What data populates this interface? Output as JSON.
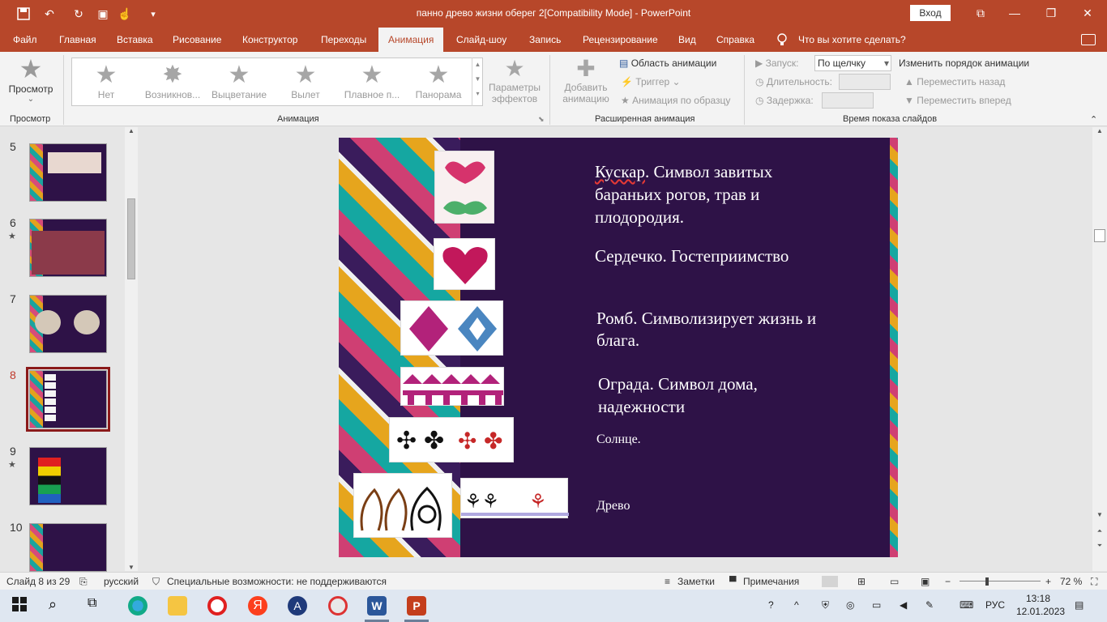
{
  "window": {
    "title": "панно древо жизни оберег 2[Compatibility Mode]  -  PowerPoint",
    "signin_label": "Вход",
    "minimize": "—",
    "restore": "❐",
    "close": "✕"
  },
  "tabs": {
    "items": [
      "Файл",
      "Главная",
      "Вставка",
      "Рисование",
      "Конструктор",
      "Переходы",
      "Анимация",
      "Слайд-шоу",
      "Запись",
      "Рецензирование",
      "Вид",
      "Справка"
    ],
    "active": "Анимация",
    "tell_me": "Что вы хотите сделать?"
  },
  "ribbon": {
    "preview": {
      "label": "Просмотр",
      "group": "Просмотр"
    },
    "animation_gallery": [
      "Нет",
      "Возникнов...",
      "Выцветание",
      "Вылет",
      "Плавное п...",
      "Панорама"
    ],
    "effect_options": [
      "Параметры",
      "эффектов"
    ],
    "animation_group": "Анимация",
    "add_animation": [
      "Добавить",
      "анимацию"
    ],
    "animation_pane": "Область анимации",
    "trigger": "Триггер",
    "animation_painter": "Анимация по образцу",
    "advanced_group": "Расширенная анимация",
    "start_label": "Запуск:",
    "start_value": "По щелчку",
    "duration_label": "Длительность:",
    "delay_label": "Задержка:",
    "reorder_title": "Изменить порядок анимации",
    "move_earlier": "Переместить назад",
    "move_later": "Переместить вперед",
    "timing_group": "Время показа слайдов"
  },
  "thumbnails": [
    {
      "num": "5",
      "star": ""
    },
    {
      "num": "6",
      "star": "★"
    },
    {
      "num": "7",
      "star": ""
    },
    {
      "num": "8",
      "star": ""
    },
    {
      "num": "9",
      "star": "★"
    },
    {
      "num": "10",
      "star": ""
    }
  ],
  "slide": {
    "t1": "Кускар. Символ завитых бараньих рогов, трав и плодородия.",
    "t1_first": "Кускар",
    "t1_rest": ". Символ завитых бараньих рогов, трав и плодородия.",
    "t2": "Сердечко. Гостеприимство",
    "t3": "Ромб. Символизирует жизнь и блага.",
    "t4": "Ограда. Символ дома, надежности",
    "t5": "Солнце.",
    "t6": "Древо"
  },
  "statusbar": {
    "slide": "Слайд 8 из 29",
    "language": "русский",
    "accessibility": "Специальные возможности: не поддерживаются",
    "notes": "Заметки",
    "comments": "Примечания",
    "zoom": "72 %"
  },
  "taskbar": {
    "lang": "РУС",
    "time": "13:18",
    "date": "12.01.2023"
  },
  "colors": {
    "accent": "#b7472a",
    "slide_bg": "#2e1247"
  }
}
